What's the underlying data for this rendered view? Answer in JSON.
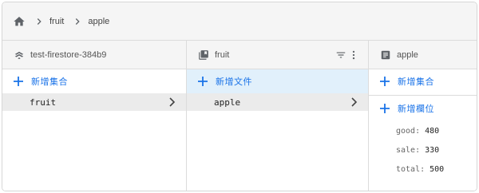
{
  "breadcrumb": {
    "items": [
      "fruit",
      "apple"
    ]
  },
  "columns": {
    "project": {
      "title": "test-firestore-384b9",
      "add_label": "新增集合",
      "items": [
        {
          "label": "fruit",
          "selected": true
        }
      ]
    },
    "collection": {
      "title": "fruit",
      "add_label": "新增文件",
      "items": [
        {
          "label": "apple",
          "selected": true
        }
      ]
    },
    "document": {
      "title": "apple",
      "add_collection_label": "新增集合",
      "add_field_label": "新增欄位",
      "fields": [
        {
          "key": "good:",
          "value": "480"
        },
        {
          "key": "sale:",
          "value": "330"
        },
        {
          "key": "total:",
          "value": "500"
        }
      ]
    }
  },
  "colors": {
    "accent": "#1a73e8",
    "selected_add": "#e1f0fb",
    "selected_item": "#ebebeb",
    "header_bg": "#f5f5f5",
    "icon": "#5f6368"
  },
  "icons": [
    "home-icon",
    "chevron-right-icon",
    "firestore-project-icon",
    "collection-icon",
    "document-icon",
    "filter-icon",
    "more-vert-icon",
    "plus-icon"
  ]
}
